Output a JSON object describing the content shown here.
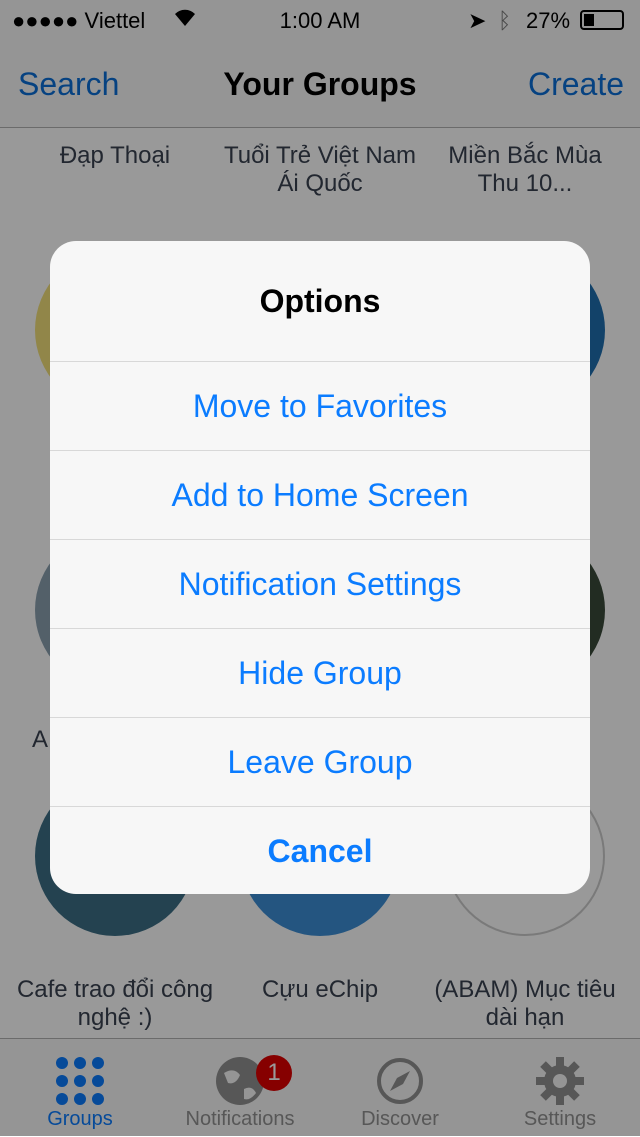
{
  "status": {
    "carrier": "●●●●● Viettel",
    "time": "1:00 AM",
    "battery": "27%"
  },
  "nav": {
    "left": "Search",
    "title": "Your Groups",
    "right": "Create"
  },
  "groups": [
    {
      "label": "Đạp Thoại",
      "color": "#555b66"
    },
    {
      "label": "Tuổi Trẻ Việt Nam Ái Quốc",
      "color": "#2d7fc9"
    },
    {
      "label": "Miền Bắc Mùa Thu 10...",
      "color": "#d8b98a"
    },
    {
      "label": "Cafe trao đổi công nghệ :)",
      "color": "#3c6f86"
    },
    {
      "label": "Cựu eChip",
      "color": "#3d8ed6"
    },
    {
      "label": "(ABAM) Mục tiêu dài hạn",
      "color": "#ffffff"
    }
  ],
  "partial_label": "A",
  "sheet": {
    "title": "Options",
    "options": [
      "Move to Favorites",
      "Add to Home Screen",
      "Notification Settings",
      "Hide Group",
      "Leave Group"
    ],
    "cancel": "Cancel"
  },
  "tabs": [
    {
      "label": "Groups",
      "icon": "grid-icon",
      "active": true
    },
    {
      "label": "Notifications",
      "icon": "globe-icon",
      "badge": "1"
    },
    {
      "label": "Discover",
      "icon": "compass-icon"
    },
    {
      "label": "Settings",
      "icon": "gear-icon"
    }
  ],
  "colors": {
    "accent": "#0b7cff",
    "badge": "#e00000"
  }
}
